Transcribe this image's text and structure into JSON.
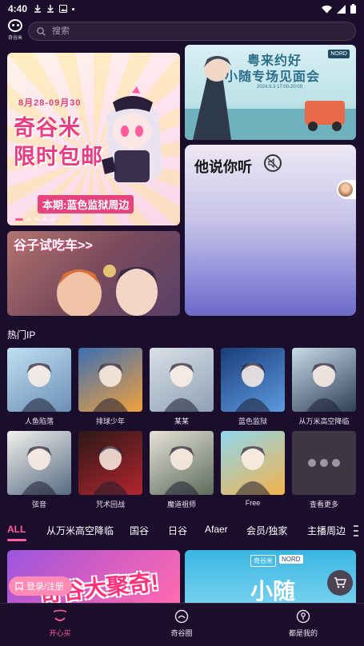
{
  "status_bar": {
    "time": "4:40"
  },
  "header": {
    "logo_label": "奇谷米",
    "search_placeholder": "搜索"
  },
  "banners": {
    "left_top": {
      "date": "8月28-09月30",
      "line1": "奇谷米",
      "line2": "限时包邮",
      "tag": "本期:蓝色监狱周边"
    },
    "left_bottom": {
      "title": "谷子试吃车>>"
    },
    "right_top": {
      "line1": "粤来约好",
      "line2": "小随专场见面会",
      "badge": "NORD",
      "sub": "2024.9.3 17:00-20:00"
    },
    "right_bottom": {
      "title": "他说你听"
    }
  },
  "hot_ip": {
    "title": "热门IP",
    "items": [
      {
        "name": "人鱼陷落",
        "colors": [
          "#bfe0f2",
          "#6c8fb6"
        ]
      },
      {
        "name": "排球少年",
        "colors": [
          "#3b6fb4",
          "#f4a13b"
        ]
      },
      {
        "name": "某某",
        "colors": [
          "#d9dfe6",
          "#8fa1b5"
        ]
      },
      {
        "name": "蓝色监狱",
        "colors": [
          "#1a3d7a",
          "#5d9be0"
        ]
      },
      {
        "name": "从万米高空降临",
        "colors": [
          "#c7dbe8",
          "#2f3f57"
        ]
      },
      {
        "name": "弦音",
        "colors": [
          "#f3f1ee",
          "#546a80"
        ]
      },
      {
        "name": "咒术回战",
        "colors": [
          "#2c1818",
          "#b3262e"
        ]
      },
      {
        "name": "魔道祖师",
        "colors": [
          "#e6e2d8",
          "#5c6b5a"
        ]
      },
      {
        "name": "Free",
        "colors": [
          "#8fd7ef",
          "#f3b24a"
        ]
      },
      {
        "name": "查看更多",
        "colors": [
          "#3d3744",
          "#3d3744"
        ]
      }
    ]
  },
  "tabs": [
    "ALL",
    "从万米高空降临",
    "国谷",
    "日谷",
    "Afaer",
    "会员/独家",
    "主播周边"
  ],
  "cards": {
    "left": {
      "title": "奇谷大聚奇!"
    },
    "right": {
      "title": "小随",
      "badge": "奇谷米",
      "badge2": "NORD"
    }
  },
  "login_label": "登录/注册",
  "bottom_nav": [
    {
      "label": "开心买",
      "active": true
    },
    {
      "label": "奇谷圈",
      "active": false
    },
    {
      "label": "都是我的",
      "active": false
    }
  ],
  "colors": {
    "accent": "#ff5c9c",
    "background": "#1b0d2c"
  }
}
